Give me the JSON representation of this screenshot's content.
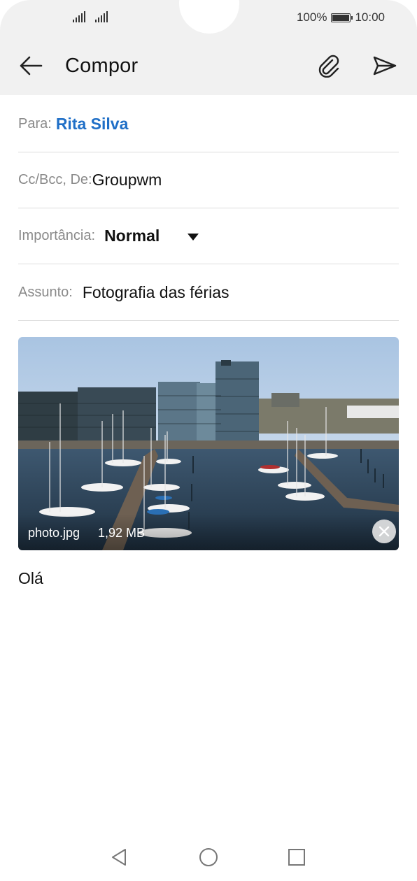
{
  "status": {
    "battery": "100%",
    "time": "10:00",
    "battery_level": 1.0
  },
  "appbar": {
    "title": "Compor"
  },
  "fields": {
    "to_label": "Para:",
    "to_value": "Rita Silva",
    "ccbcc_label": "Cc/Bcc, De:",
    "ccbcc_value": "Groupwm",
    "importance_label": "Importância:",
    "importance_value": "Normal",
    "subject_label": "Assunto:",
    "subject_value": "Fotografia das férias"
  },
  "attachment": {
    "filename": "photo.jpg",
    "size": "1,92 MB"
  },
  "body": {
    "text": "Olá"
  },
  "icons": {
    "back": "arrow-left",
    "attach": "paperclip",
    "send": "paper-plane",
    "remove": "close",
    "nav_back": "triangle-left",
    "nav_home": "circle",
    "nav_recents": "square"
  },
  "colors": {
    "accent": "#1f6fc7",
    "appbar_bg": "#f1f1f1",
    "divider": "#dcdcdc"
  }
}
